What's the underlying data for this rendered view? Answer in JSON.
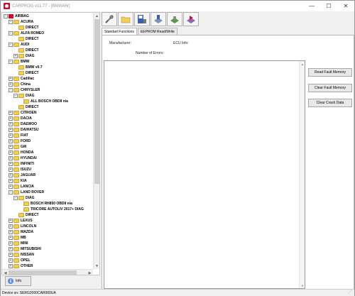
{
  "window": {
    "title": "CARPROG  v11.77 - [BMW46r]",
    "minimize": "—",
    "maximize": "☐",
    "close": "✕"
  },
  "tree": {
    "nodes": [
      {
        "label": "AIRBAG",
        "depth": 0,
        "kind": "root"
      },
      {
        "label": "ACURA",
        "depth": 1,
        "kind": "expanded"
      },
      {
        "label": "DIRECT",
        "depth": 2,
        "kind": "leaf"
      },
      {
        "label": "ALFA ROMEO",
        "depth": 1,
        "kind": "expanded"
      },
      {
        "label": "DIRECT",
        "depth": 2,
        "kind": "leaf"
      },
      {
        "label": "AUDI",
        "depth": 1,
        "kind": "expanded"
      },
      {
        "label": "DIRECT",
        "depth": 2,
        "kind": "leaf"
      },
      {
        "label": "DIAG",
        "depth": 2,
        "kind": "collapsed"
      },
      {
        "label": "BMW",
        "depth": 1,
        "kind": "expanded"
      },
      {
        "label": "BMW v0.7",
        "depth": 2,
        "kind": "leaf"
      },
      {
        "label": "DIRECT",
        "depth": 2,
        "kind": "leaf"
      },
      {
        "label": "Cadillac",
        "depth": 1,
        "kind": "collapsed"
      },
      {
        "label": "China",
        "depth": 1,
        "kind": "collapsed"
      },
      {
        "label": "CHRYSLER",
        "depth": 1,
        "kind": "expanded"
      },
      {
        "label": "DIAG",
        "depth": 2,
        "kind": "expanded"
      },
      {
        "label": "ALL BOSCH OBDII n/a",
        "depth": 3,
        "kind": "leaf"
      },
      {
        "label": "DIRECT",
        "depth": 2,
        "kind": "leaf"
      },
      {
        "label": "CITROEN",
        "depth": 1,
        "kind": "collapsed"
      },
      {
        "label": "DACIA",
        "depth": 1,
        "kind": "collapsed"
      },
      {
        "label": "DAEWOO",
        "depth": 1,
        "kind": "collapsed"
      },
      {
        "label": "DAIHATSU",
        "depth": 1,
        "kind": "collapsed"
      },
      {
        "label": "FIAT",
        "depth": 1,
        "kind": "collapsed"
      },
      {
        "label": "FORD",
        "depth": 1,
        "kind": "collapsed"
      },
      {
        "label": "GM",
        "depth": 1,
        "kind": "collapsed"
      },
      {
        "label": "HONDA",
        "depth": 1,
        "kind": "collapsed"
      },
      {
        "label": "HYUNDAI",
        "depth": 1,
        "kind": "collapsed"
      },
      {
        "label": "INFINITI",
        "depth": 1,
        "kind": "collapsed"
      },
      {
        "label": "ISUZU",
        "depth": 1,
        "kind": "collapsed"
      },
      {
        "label": "JAGUAR",
        "depth": 1,
        "kind": "collapsed"
      },
      {
        "label": "KIA",
        "depth": 1,
        "kind": "collapsed"
      },
      {
        "label": "LANCIA",
        "depth": 1,
        "kind": "collapsed"
      },
      {
        "label": "LAND ROVER",
        "depth": 1,
        "kind": "expanded"
      },
      {
        "label": "DIAG",
        "depth": 2,
        "kind": "expanded"
      },
      {
        "label": "BOSCH RH850 OBDII n/a",
        "depth": 3,
        "kind": "leaf"
      },
      {
        "label": "TRICORE AUTOLIV 2017+ DIAG",
        "depth": 3,
        "kind": "leaf"
      },
      {
        "label": "DIRECT",
        "depth": 2,
        "kind": "leaf"
      },
      {
        "label": "LEXUS",
        "depth": 1,
        "kind": "collapsed"
      },
      {
        "label": "LINCOLN",
        "depth": 1,
        "kind": "collapsed"
      },
      {
        "label": "MAZDA",
        "depth": 1,
        "kind": "collapsed"
      },
      {
        "label": "MB",
        "depth": 1,
        "kind": "collapsed"
      },
      {
        "label": "MINI",
        "depth": 1,
        "kind": "collapsed"
      },
      {
        "label": "MITSUBISHI",
        "depth": 1,
        "kind": "collapsed"
      },
      {
        "label": "NISSAN",
        "depth": 1,
        "kind": "collapsed"
      },
      {
        "label": "OPEL",
        "depth": 1,
        "kind": "collapsed"
      },
      {
        "label": "OTHER",
        "depth": 1,
        "kind": "collapsed"
      }
    ]
  },
  "info_button": {
    "label": "Info",
    "icon": "info-icon"
  },
  "toolbar": [
    {
      "name": "tools-icon"
    },
    {
      "name": "folder-icon"
    },
    {
      "name": "save-floppy-icon"
    },
    {
      "name": "write-device-icon"
    },
    {
      "name": "chip-icon"
    },
    {
      "name": "play-arrow-icon"
    }
  ],
  "tabs": [
    {
      "label": "Standart Functions",
      "active": true
    },
    {
      "label": "EEPROM Read/Write",
      "active": false
    }
  ],
  "panel": {
    "manufacturer_label": "Manufacturer:",
    "ecu_info_label": "ECU Info:",
    "errors_label": "Number of Errors:",
    "buttons": {
      "read_fault": "Read Fault Memory",
      "clear_fault": "Clear Fault Memory",
      "clear_crash": "Clear Crash Data"
    }
  },
  "status": {
    "device": "Device sn: SERG2000CAR000UA"
  },
  "colors": {
    "folder": "#f2cf5b",
    "accent_red": "#c8102e"
  }
}
